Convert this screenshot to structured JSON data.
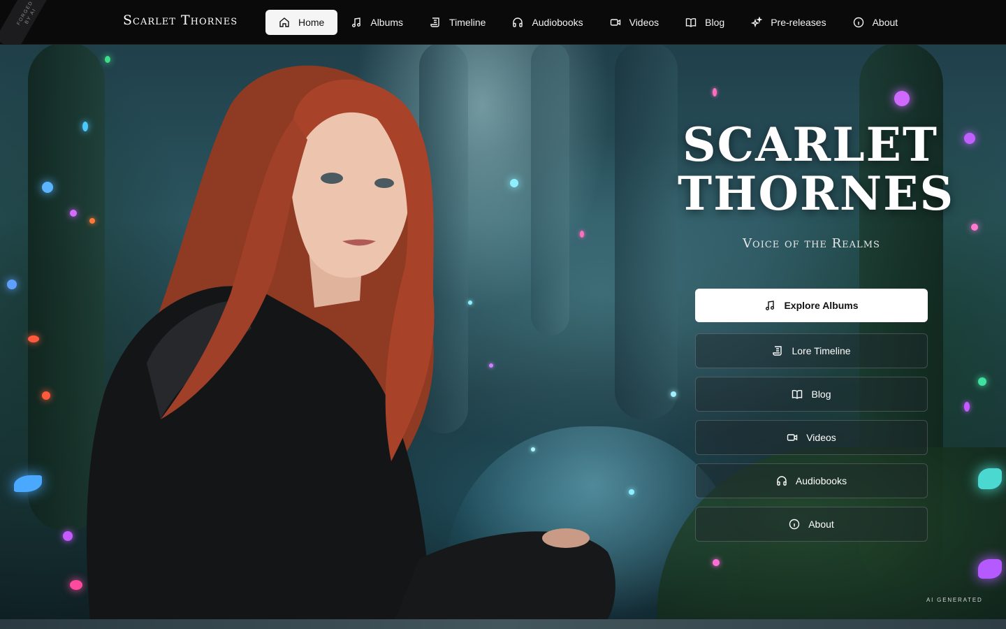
{
  "brand": {
    "name": "Scarlet Thornes"
  },
  "corner_ribbon": {
    "text": "FORGED BY AI"
  },
  "nav": {
    "items": [
      {
        "label": "Home",
        "icon": "home-icon",
        "active": true
      },
      {
        "label": "Albums",
        "icon": "music-note-icon"
      },
      {
        "label": "Timeline",
        "icon": "scroll-icon"
      },
      {
        "label": "Audiobooks",
        "icon": "headphones-icon"
      },
      {
        "label": "Videos",
        "icon": "video-camera-icon"
      },
      {
        "label": "Blog",
        "icon": "open-book-icon"
      },
      {
        "label": "Pre-releases",
        "icon": "sparkles-icon"
      },
      {
        "label": "About",
        "icon": "info-icon"
      }
    ]
  },
  "hero": {
    "title_line1": "SCARLET",
    "title_line2": "THORNES",
    "subtitle": "Voice of the Realms",
    "buttons": [
      {
        "label": "Explore Albums",
        "icon": "music-note-icon",
        "primary": true
      },
      {
        "label": "Lore Timeline",
        "icon": "scroll-icon"
      },
      {
        "label": "Blog",
        "icon": "open-book-icon"
      },
      {
        "label": "Videos",
        "icon": "video-camera-icon"
      },
      {
        "label": "Audiobooks",
        "icon": "headphones-icon"
      },
      {
        "label": "About",
        "icon": "info-icon"
      }
    ],
    "ai_tag": "AI GENERATED"
  },
  "colors": {
    "nav_bg": "#0a0a0b",
    "active_pill": "#f5f5f5",
    "hair": "#a8432a",
    "forest_teal": "#2b5560"
  }
}
